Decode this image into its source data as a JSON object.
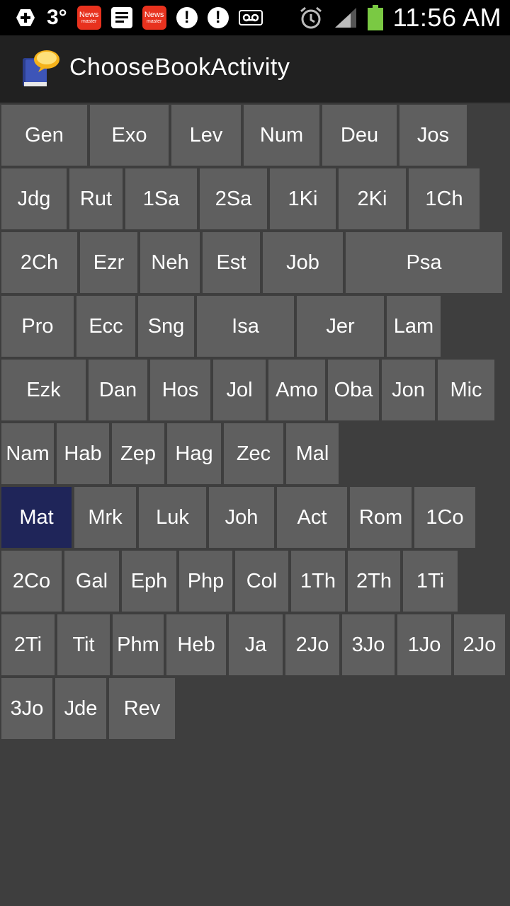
{
  "status_bar": {
    "temperature": "3°",
    "news_label": "News",
    "news_sub": "master",
    "exclamation": "!",
    "time": "11:56 AM"
  },
  "action_bar": {
    "title": "ChooseBookActivity",
    "icon": "bible-chat-icon"
  },
  "books": {
    "rows": [
      [
        "Gen",
        "Exo",
        "Lev",
        "Num",
        "Deu",
        "Jos"
      ],
      [
        "Jdg",
        "Rut",
        "1Sa",
        "2Sa",
        "1Ki",
        "2Ki",
        "1Ch"
      ],
      [
        "2Ch",
        "Ezr",
        "Neh",
        "Est",
        "Job",
        "Psa"
      ],
      [
        "Pro",
        "Ecc",
        "Sng",
        "Isa",
        "Jer",
        "Lam"
      ],
      [
        "Ezk",
        "Dan",
        "Hos",
        "Jol",
        "Amo",
        "Oba",
        "Jon",
        "Mic"
      ],
      [
        "Nam",
        "Hab",
        "Zep",
        "Hag",
        "Zec",
        "Mal"
      ],
      [
        "Mat",
        "Mrk",
        "Luk",
        "Joh",
        "Act",
        "Rom",
        "1Co"
      ],
      [
        "2Co",
        "Gal",
        "Eph",
        "Php",
        "Col",
        "1Th",
        "2Th",
        "1Ti"
      ],
      [
        "2Ti",
        "Tit",
        "Phm",
        "Heb",
        "Ja",
        "2Jo",
        "3Jo",
        "1Jo",
        "2Jo"
      ],
      [
        "3Jo",
        "Jde",
        "Rev"
      ]
    ],
    "selected": "Mat",
    "colors": {
      "button": "#5f5f5f",
      "selected": "#1f2559",
      "background": "#3e3e3e"
    }
  }
}
